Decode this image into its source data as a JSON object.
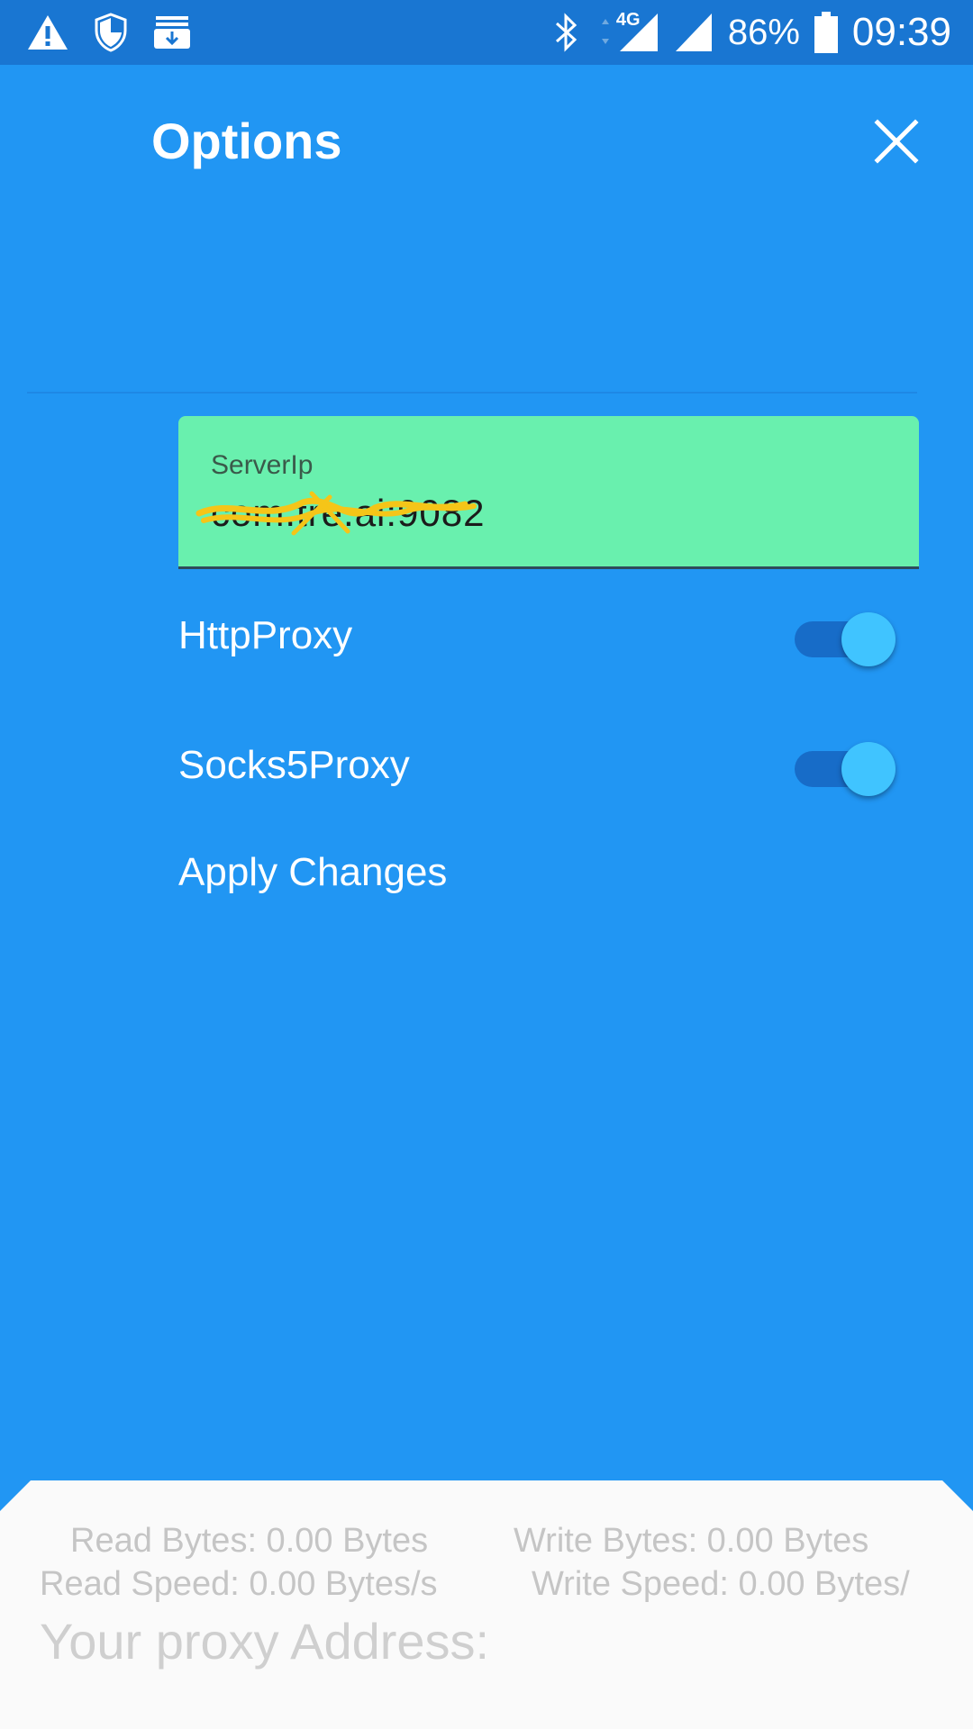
{
  "status_bar": {
    "left_icons": [
      "warning-icon",
      "shield-icon",
      "download-tray-icon"
    ],
    "right_icons": [
      "bluetooth-icon",
      "signal-4g-icon",
      "signal-icon",
      "battery-icon"
    ],
    "network_label": "4G",
    "battery_percent": "86%",
    "time": "09:39"
  },
  "header": {
    "title": "Options",
    "close_icon": "close-icon"
  },
  "server_field": {
    "label": "ServerIp",
    "value": "com.tre.ai:9082",
    "scribble_color": "#F5C518"
  },
  "toggles": [
    {
      "label": "HttpProxy",
      "on": true
    },
    {
      "label": "Socks5Proxy",
      "on": true
    }
  ],
  "apply_label": "Apply Changes",
  "bottom_sheet": {
    "read_bytes": "Read Bytes: 0.00 Bytes",
    "write_bytes": "Write Bytes: 0.00 Bytes",
    "read_speed": "Read Speed: 0.00 Bytes/s",
    "write_speed": "Write Speed: 0.00 Bytes/",
    "proxy_address": "Your proxy Address:"
  },
  "colors": {
    "background": "#2196F3",
    "status_bar": "#1976D2",
    "field_bg": "#69F0AE",
    "switch_thumb": "#40C4FF",
    "sheet_bg": "#FAFAFA"
  }
}
